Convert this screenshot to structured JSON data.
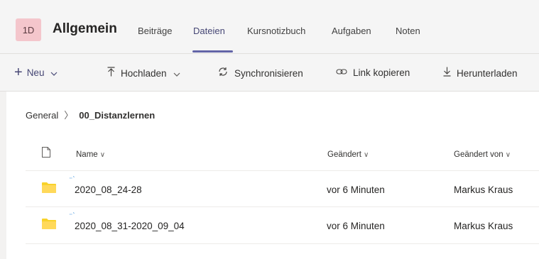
{
  "header": {
    "team_badge": "1D",
    "channel_title": "Allgemein",
    "tabs": [
      {
        "label": "Beiträge",
        "active": false
      },
      {
        "label": "Dateien",
        "active": true
      },
      {
        "label": "Kursnotizbuch",
        "active": false
      },
      {
        "label": "Aufgaben",
        "active": false
      },
      {
        "label": "Noten",
        "active": false
      }
    ]
  },
  "toolbar": {
    "new_label": "Neu",
    "upload_label": "Hochladen",
    "sync_label": "Synchronisieren",
    "copy_link_label": "Link kopieren",
    "download_label": "Herunterladen"
  },
  "breadcrumb": {
    "root": "General",
    "current": "00_Distanzlernen"
  },
  "table": {
    "columns": {
      "name": "Name",
      "modified": "Geändert",
      "modified_by": "Geändert von"
    },
    "rows": [
      {
        "name": "2020_08_24-28",
        "modified": "vor 6 Minuten",
        "modified_by": "Markus Kraus"
      },
      {
        "name": "2020_08_31-2020_09_04",
        "modified": "vor 6 Minuten",
        "modified_by": "Markus Kraus"
      }
    ]
  },
  "colors": {
    "accent": "#6264a7",
    "badge": "#f4c6cc",
    "folder": "#f8d22a",
    "sync": "#2b88d8"
  }
}
